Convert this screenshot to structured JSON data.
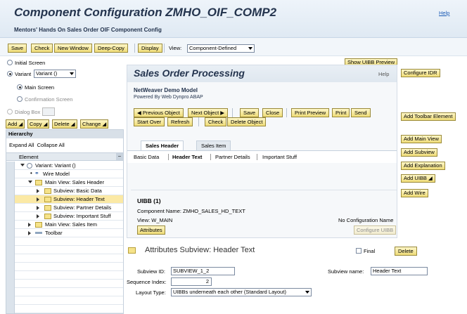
{
  "header": {
    "title": "Component Configuration ZMHO_OIF_COMP2",
    "subtitle": "Mentors' Hands On Sales Order OIF Component Config",
    "help": "Help"
  },
  "toolbar": {
    "save": "Save",
    "check": "Check",
    "new_window": "New Window",
    "deep_copy": "Deep-Copy",
    "display": "Display",
    "view_label": "View:",
    "view_value": "Component-Defined"
  },
  "left": {
    "initial_screen": "Initial Screen",
    "variant_label": "Variant",
    "variant_value": "Variant ()",
    "main_screen": "Main Screen",
    "confirmation_screen": "Confirmation Screen",
    "dialog_box": "Dialog Box",
    "add": "Add",
    "copy": "Copy",
    "delete": "Delete",
    "change": "Change",
    "hierarchy_title": "Hierarchy",
    "expand_all": "Expand All",
    "collapse_all": "Collapse All",
    "column_element": "Element",
    "tree": [
      "Variant: Variant ()",
      "Wire Model",
      "Main View: Sales Header",
      "Subview: Basic Data",
      "Subview: Header Text",
      "Subview: Partner Details",
      "Subview: Important Stuff",
      "Main View: Sales Item",
      "Toolbar"
    ]
  },
  "preview": {
    "show_uibb_preview": "Show UIBB Preview",
    "title": "Sales Order Processing",
    "help": "Help",
    "model": "NetWeaver Demo Model",
    "powered": "Powered By Web Dynpro ABAP",
    "buttons": {
      "prev": "Previous Object",
      "next": "Next Object",
      "save": "Save",
      "close": "Close",
      "print_preview": "Print Preview",
      "print": "Print",
      "send": "Send",
      "start_over": "Start Over",
      "refresh": "Refresh",
      "check": "Check",
      "delete_object": "Delete Object"
    },
    "tabs": {
      "sales_header": "Sales Header",
      "sales_item": "Sales Item"
    },
    "subtabs": [
      "Basic Data",
      "Header Text",
      "Partner Details",
      "Important Stuff"
    ],
    "uibb": {
      "title": "UIBB (1)",
      "component": "Component Name: ZMHO_SALES_HD_TEXT",
      "view": "View: W_MAIN",
      "no_config": "No Configuration Name",
      "attributes": "Attributes",
      "configure_uibb": "Configure UIBB"
    }
  },
  "right_buttons": {
    "configure_idr": "Configure IDR",
    "add_toolbar_element": "Add Toolbar Element",
    "add_main_view": "Add Main View",
    "add_subview": "Add Subview",
    "add_explanation": "Add Explanation",
    "add_uibb": "Add UIBB",
    "add_wire": "Add Wire"
  },
  "attributes": {
    "title": "Attributes Subview: Header Text",
    "final": "Final",
    "delete": "Delete",
    "subview_id_label": "Subview ID:",
    "subview_id_value": "SUBVIEW_1_2",
    "subview_name_label": "Subview name:",
    "subview_name_value": "Header Text",
    "sequence_label": "Sequence Index:",
    "sequence_value": "2",
    "layout_label": "Layout Type:",
    "layout_value": "UIBBs underneath each other (Standard Layout)"
  }
}
